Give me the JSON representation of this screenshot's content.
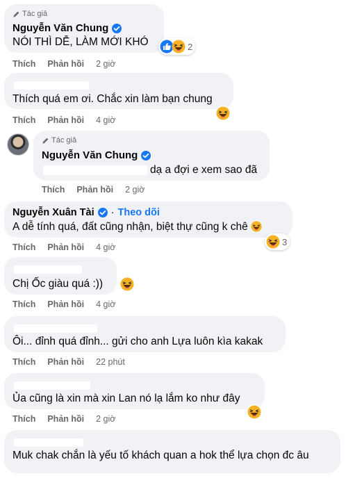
{
  "author_badge": "Tác giả",
  "action_labels": {
    "like": "Thích",
    "reply": "Phản hồi"
  },
  "comments": [
    {
      "name": "Nguyễn Văn Chung",
      "text": "NÓI THÌ DỄ, LÀM MỚI KHÓ",
      "time": "2 giờ",
      "reaction_count": "2"
    },
    {
      "text": "Thích quá em ơi. Chắc xin làm bạn chung",
      "time": "4 giờ"
    },
    {
      "name": "Nguyễn Văn Chung",
      "text": "dạ a đợi e xem sao đã",
      "time": "2 giờ"
    },
    {
      "name": "Nguyễn Xuân Tài",
      "follow": "Theo dõi",
      "text": "A dễ tính quá, đất cũng nhận, biệt thự cũng k chê",
      "time": "4 giờ",
      "reaction_count": "3"
    },
    {
      "text": "Chị Ốc giàu quá :))",
      "time": "4 giờ"
    },
    {
      "text": "Ôi... đỉnh quá đỉnh... gửi cho anh Lựa luôn kìa kakak",
      "time": "22 phút"
    },
    {
      "text": "Ủa cũng là xin mà xin Lan nó lạ lắm ko như đây",
      "time": "2 giờ"
    },
    {
      "text": "Muk chak chắn là yếu tố khách quan a hok thể lựa chọn đc âu"
    }
  ],
  "colors": {
    "bubble": "#f0f2f5",
    "blue": "#1877f2",
    "secondary_text": "#65676b",
    "haha_yellow": "#f7b125"
  }
}
